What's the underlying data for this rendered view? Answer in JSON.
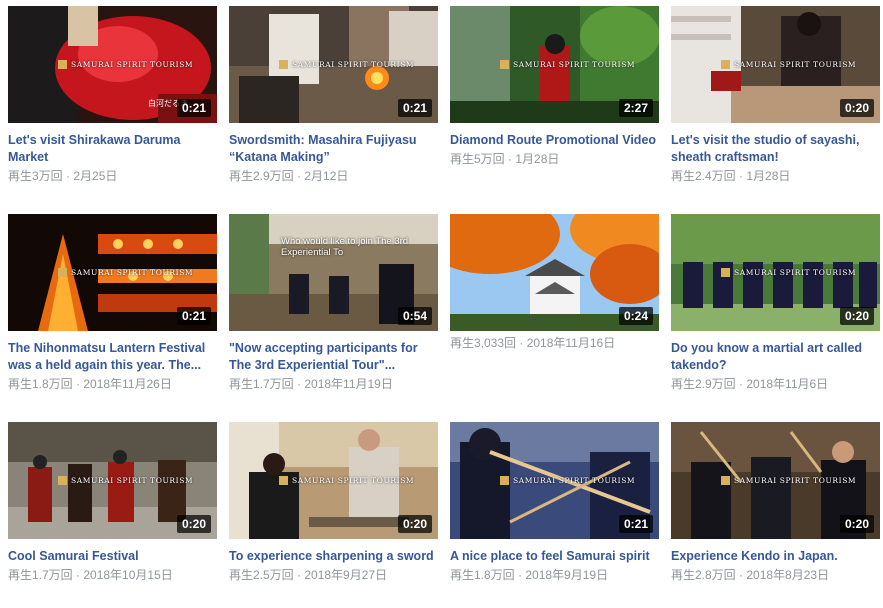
{
  "watermark": "SAMURAI SPIRIT TOURISM",
  "videos": [
    {
      "title": "Let's visit Shirakawa Daruma Market",
      "duration": "0:21",
      "views": "再生3万回",
      "date": "2月25日"
    },
    {
      "title": "Swordsmith: Masahira Fujiyasu “Katana Making”",
      "duration": "0:21",
      "views": "再生2.9万回",
      "date": "2月12日"
    },
    {
      "title": "Diamond Route Promotional Video",
      "duration": "2:27",
      "views": "再生5万回",
      "date": "1月28日"
    },
    {
      "title": "Let's visit the studio of sayashi, sheath craftsman!",
      "duration": "0:20",
      "views": "再生2.4万回",
      "date": "1月28日"
    },
    {
      "title": "The Nihonmatsu Lantern Festival was a held again this year. The...",
      "duration": "0:21",
      "views": "再生1.8万回",
      "date": "2018年11月26日"
    },
    {
      "title": "\"Now accepting participants for The 3rd Experiential Tour\"...",
      "duration": "0:54",
      "views": "再生1.7万回",
      "date": "2018年11月19日",
      "overlay": "Who would like to join The 3rd Experiential To"
    },
    {
      "title": "",
      "duration": "0:24",
      "views": "再生3,033回",
      "date": "2018年11月16日"
    },
    {
      "title": "Do you know a martial art called takendo?",
      "duration": "0:20",
      "views": "再生2.9万回",
      "date": "2018年11月6日"
    },
    {
      "title": "Cool Samurai Festival",
      "duration": "0:20",
      "views": "再生1.7万回",
      "date": "2018年10月15日"
    },
    {
      "title": "To experience sharpening a sword",
      "duration": "0:20",
      "views": "再生2.5万回",
      "date": "2018年9月27日"
    },
    {
      "title": "A nice place to feel Samurai spirit",
      "duration": "0:21",
      "views": "再生1.8万回",
      "date": "2018年9月19日"
    },
    {
      "title": "Experience Kendo in Japan.",
      "duration": "0:20",
      "views": "再生2.8万回",
      "date": "2018年8月23日"
    }
  ],
  "meta_separator": " · ",
  "colors": {
    "title": "#365899",
    "meta": "#90949c",
    "duration_bg": "#000000",
    "watermark_logo": "#d9b15a"
  }
}
